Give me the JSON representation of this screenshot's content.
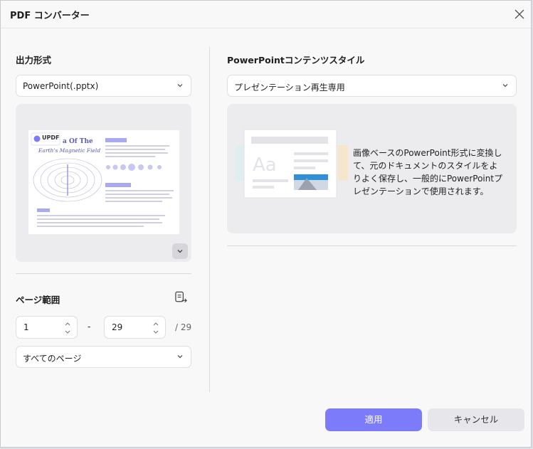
{
  "window": {
    "title": "PDF コンバーター"
  },
  "left": {
    "output_format_label": "出力形式",
    "output_format_value": "PowerPoint(.pptx)",
    "preview": {
      "logo_text": "UPDF",
      "doc_title_line1": "a Of The",
      "doc_title_line2": "Earth's Magnetic Field"
    },
    "page_range_label": "ページ範囲",
    "range_from": "1",
    "range_dash": "-",
    "range_to": "29",
    "range_total": "/ 29",
    "page_subset_value": "すべてのページ"
  },
  "right": {
    "content_style_label": "PowerPointコンテンツスタイル",
    "content_style_value": "プレゼンテーション再生専用",
    "description": "画像ベースのPowerPoint形式に変換して、元のドキュメントのスタイルをよりよく保存し、一般的にPowerPointプレゼンテーションで使用されます。",
    "sample_text": "Aa"
  },
  "footer": {
    "apply_label": "適用",
    "cancel_label": "キャンセル"
  },
  "colors": {
    "primary": "#7c7cfb",
    "secondary_bg": "#e7e7eb"
  }
}
